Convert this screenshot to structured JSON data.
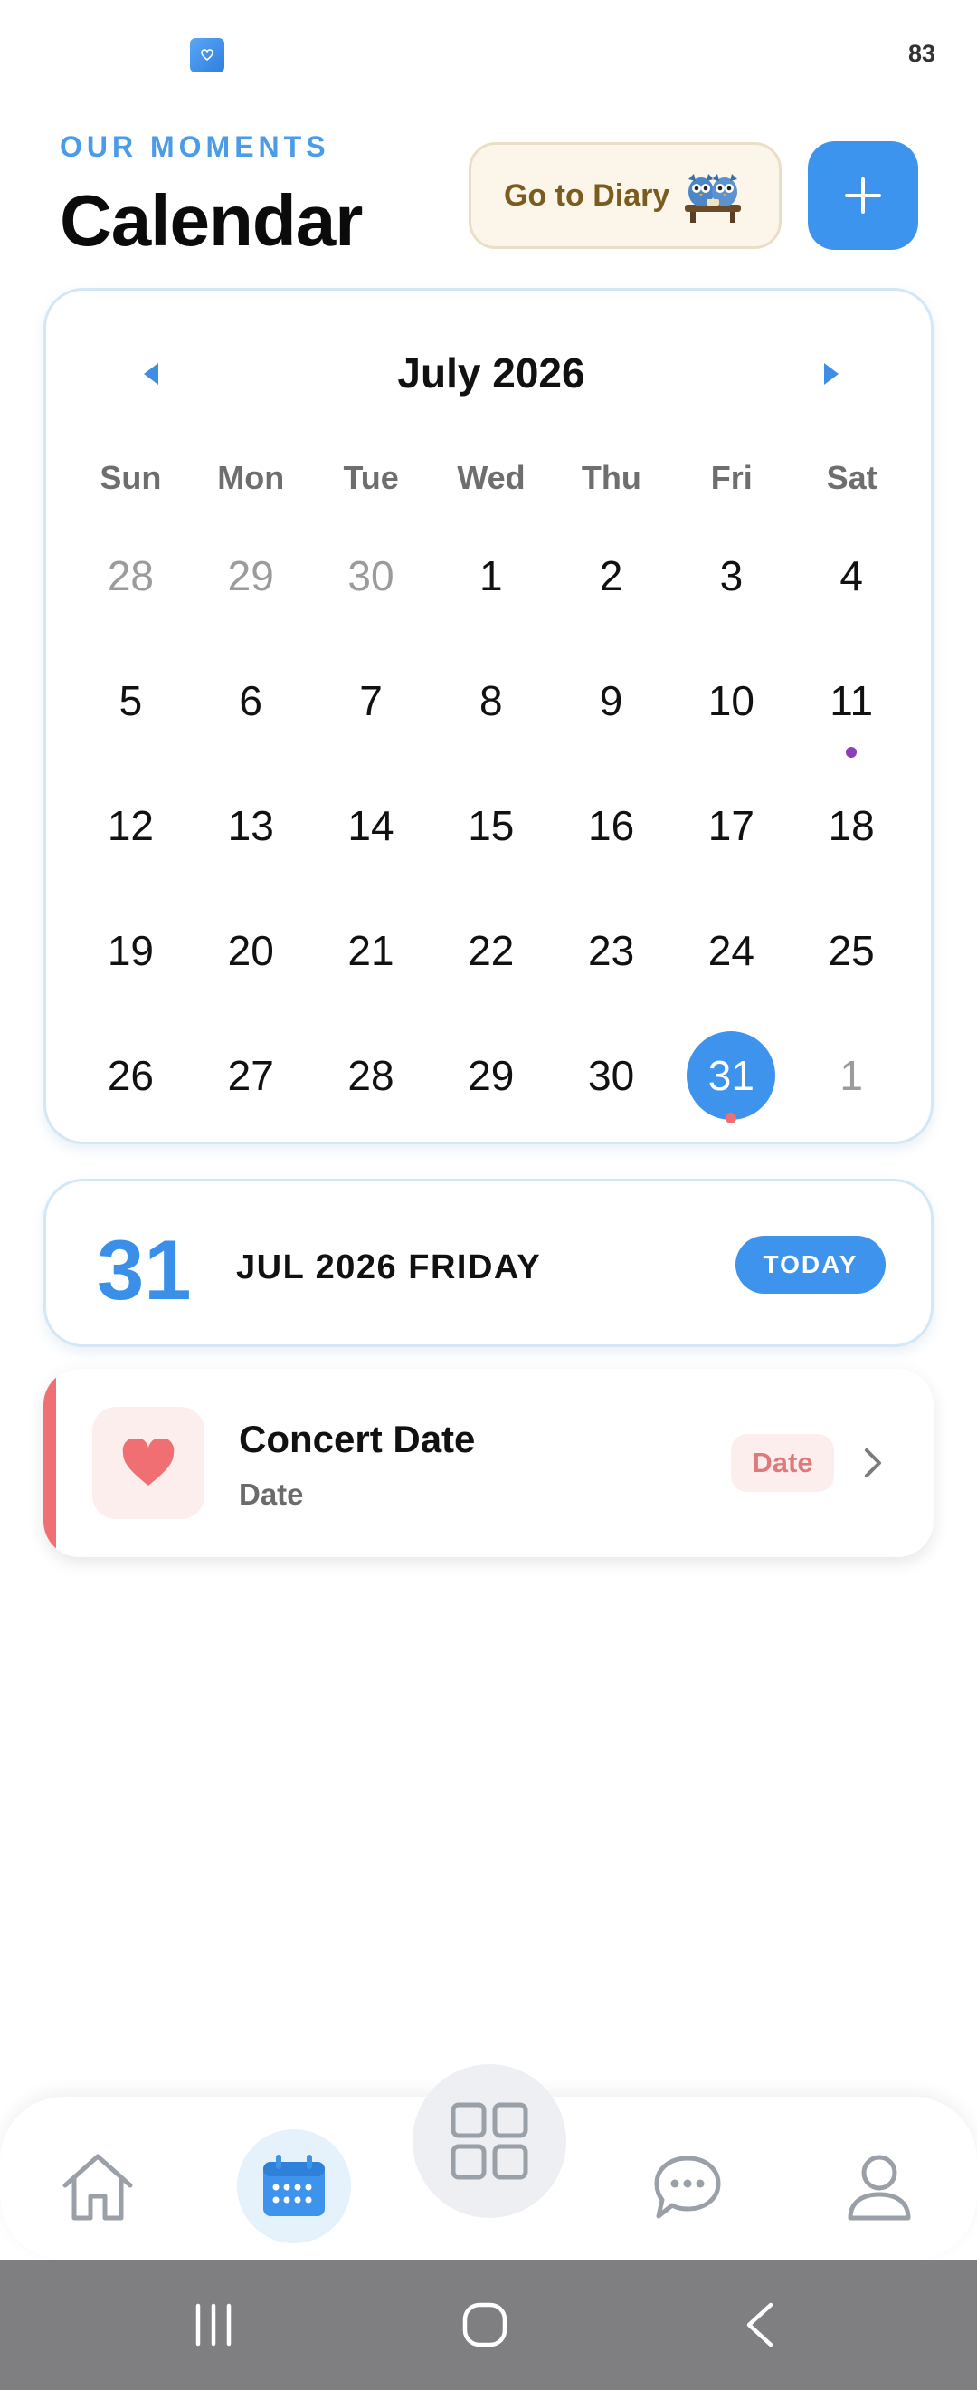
{
  "status_bar": {
    "battery": "83"
  },
  "header": {
    "eyebrow": "OUR MOMENTS",
    "title": "Calendar",
    "diary_button_label": "Go to Diary",
    "add_button_icon": "plus-icon"
  },
  "calendar": {
    "month_title": "July 2026",
    "weekdays": [
      "Sun",
      "Mon",
      "Tue",
      "Wed",
      "Thu",
      "Fri",
      "Sat"
    ],
    "weeks": [
      [
        {
          "d": "28",
          "muted": true
        },
        {
          "d": "29",
          "muted": true
        },
        {
          "d": "30",
          "muted": true
        },
        {
          "d": "1"
        },
        {
          "d": "2"
        },
        {
          "d": "3"
        },
        {
          "d": "4"
        }
      ],
      [
        {
          "d": "5"
        },
        {
          "d": "6"
        },
        {
          "d": "7"
        },
        {
          "d": "8"
        },
        {
          "d": "9"
        },
        {
          "d": "10"
        },
        {
          "d": "11",
          "dot": "#8e3fb5"
        }
      ],
      [
        {
          "d": "12"
        },
        {
          "d": "13"
        },
        {
          "d": "14"
        },
        {
          "d": "15"
        },
        {
          "d": "16"
        },
        {
          "d": "17"
        },
        {
          "d": "18"
        }
      ],
      [
        {
          "d": "19"
        },
        {
          "d": "20"
        },
        {
          "d": "21"
        },
        {
          "d": "22"
        },
        {
          "d": "23"
        },
        {
          "d": "24"
        },
        {
          "d": "25"
        }
      ],
      [
        {
          "d": "26"
        },
        {
          "d": "27"
        },
        {
          "d": "28"
        },
        {
          "d": "29"
        },
        {
          "d": "30"
        },
        {
          "d": "31",
          "selected": true,
          "dot": "#ef6f73"
        },
        {
          "d": "1",
          "muted": true
        }
      ]
    ]
  },
  "today": {
    "day": "31",
    "date_text": "JUL 2026 FRIDAY",
    "badge": "TODAY"
  },
  "events": [
    {
      "title": "Concert Date",
      "subtitle": "Date",
      "tag": "Date",
      "icon": "heart-icon",
      "accent": "#ef6f73"
    }
  ],
  "bottom_nav": {
    "items": [
      "home-icon",
      "calendar-icon",
      "grid-icon",
      "chat-icon",
      "profile-icon"
    ],
    "active": "calendar-icon"
  },
  "colors": {
    "primary": "#3e93ec",
    "accent_red": "#ef6f73",
    "diary_bg": "#fbf5ea"
  }
}
